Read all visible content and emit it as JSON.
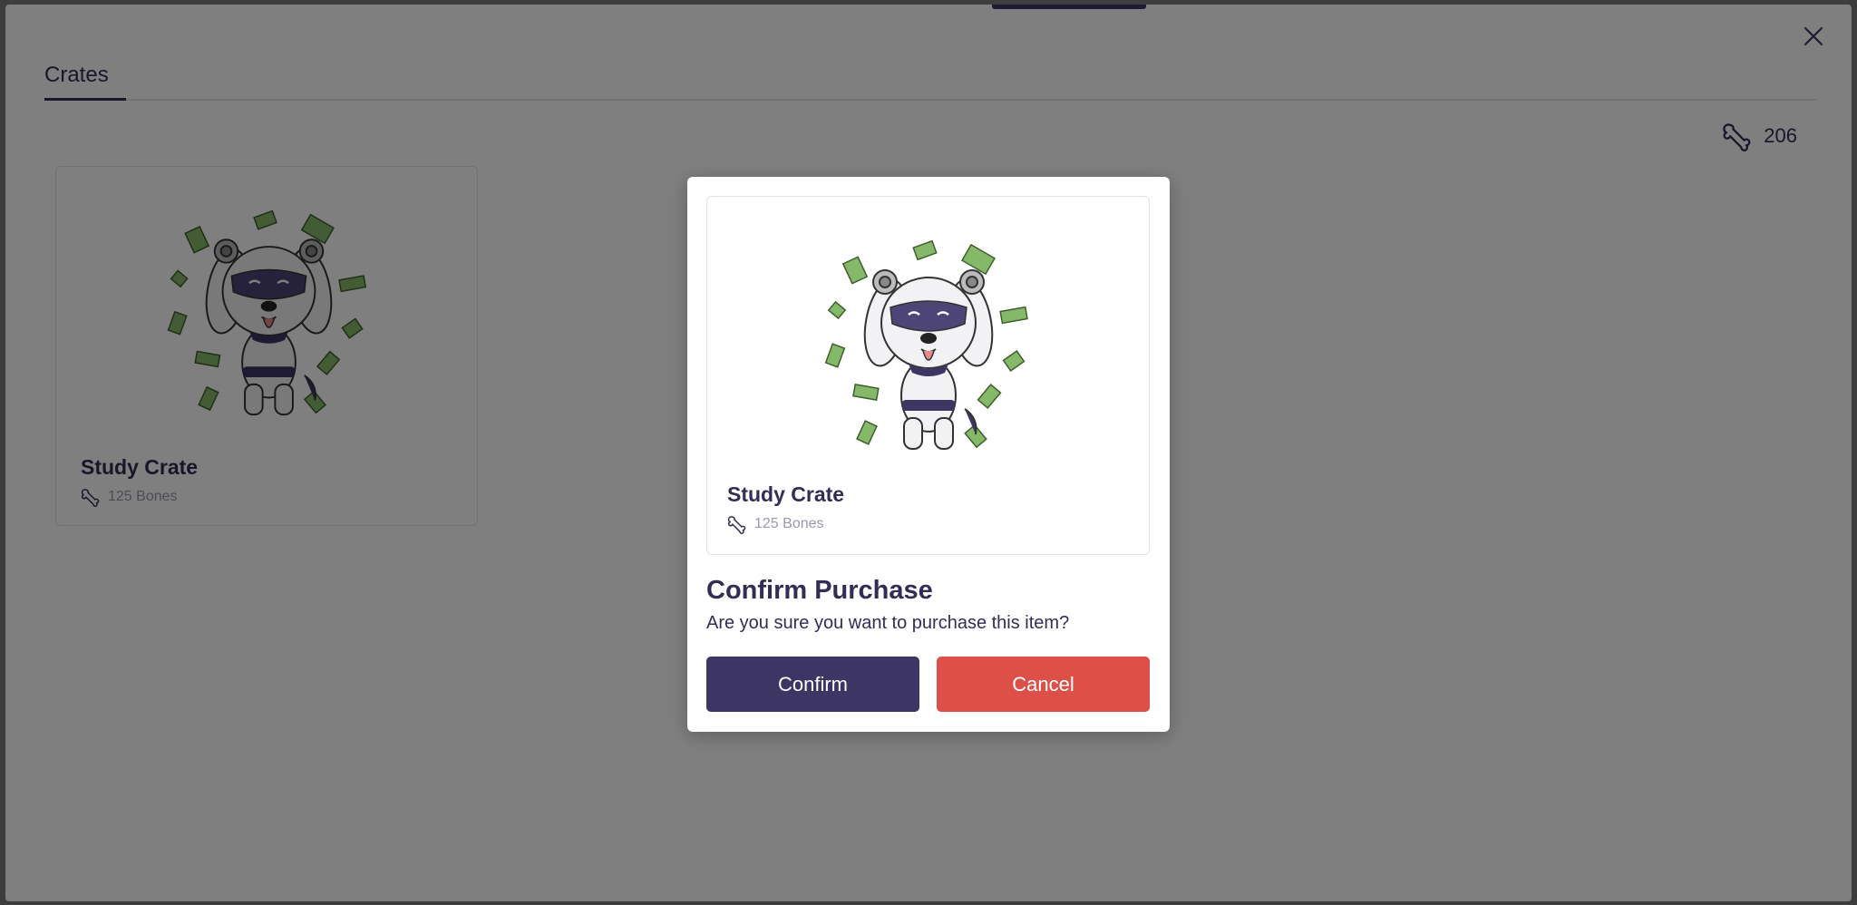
{
  "tabs": [
    {
      "label": "Crates",
      "active": true
    }
  ],
  "balance": {
    "icon": "bone-icon",
    "amount": "206"
  },
  "crates": [
    {
      "title": "Study Crate",
      "price": "125 Bones",
      "image": "dog-mascot-money-illustration"
    }
  ],
  "modal": {
    "item": {
      "title": "Study Crate",
      "price": "125 Bones"
    },
    "heading": "Confirm Purchase",
    "message": "Are you sure you want to purchase this item?",
    "confirm_label": "Confirm",
    "cancel_label": "Cancel"
  },
  "colors": {
    "primary": "#3d3563",
    "danger": "#dc5049",
    "text": "#342c54",
    "money": "#7fb069"
  }
}
